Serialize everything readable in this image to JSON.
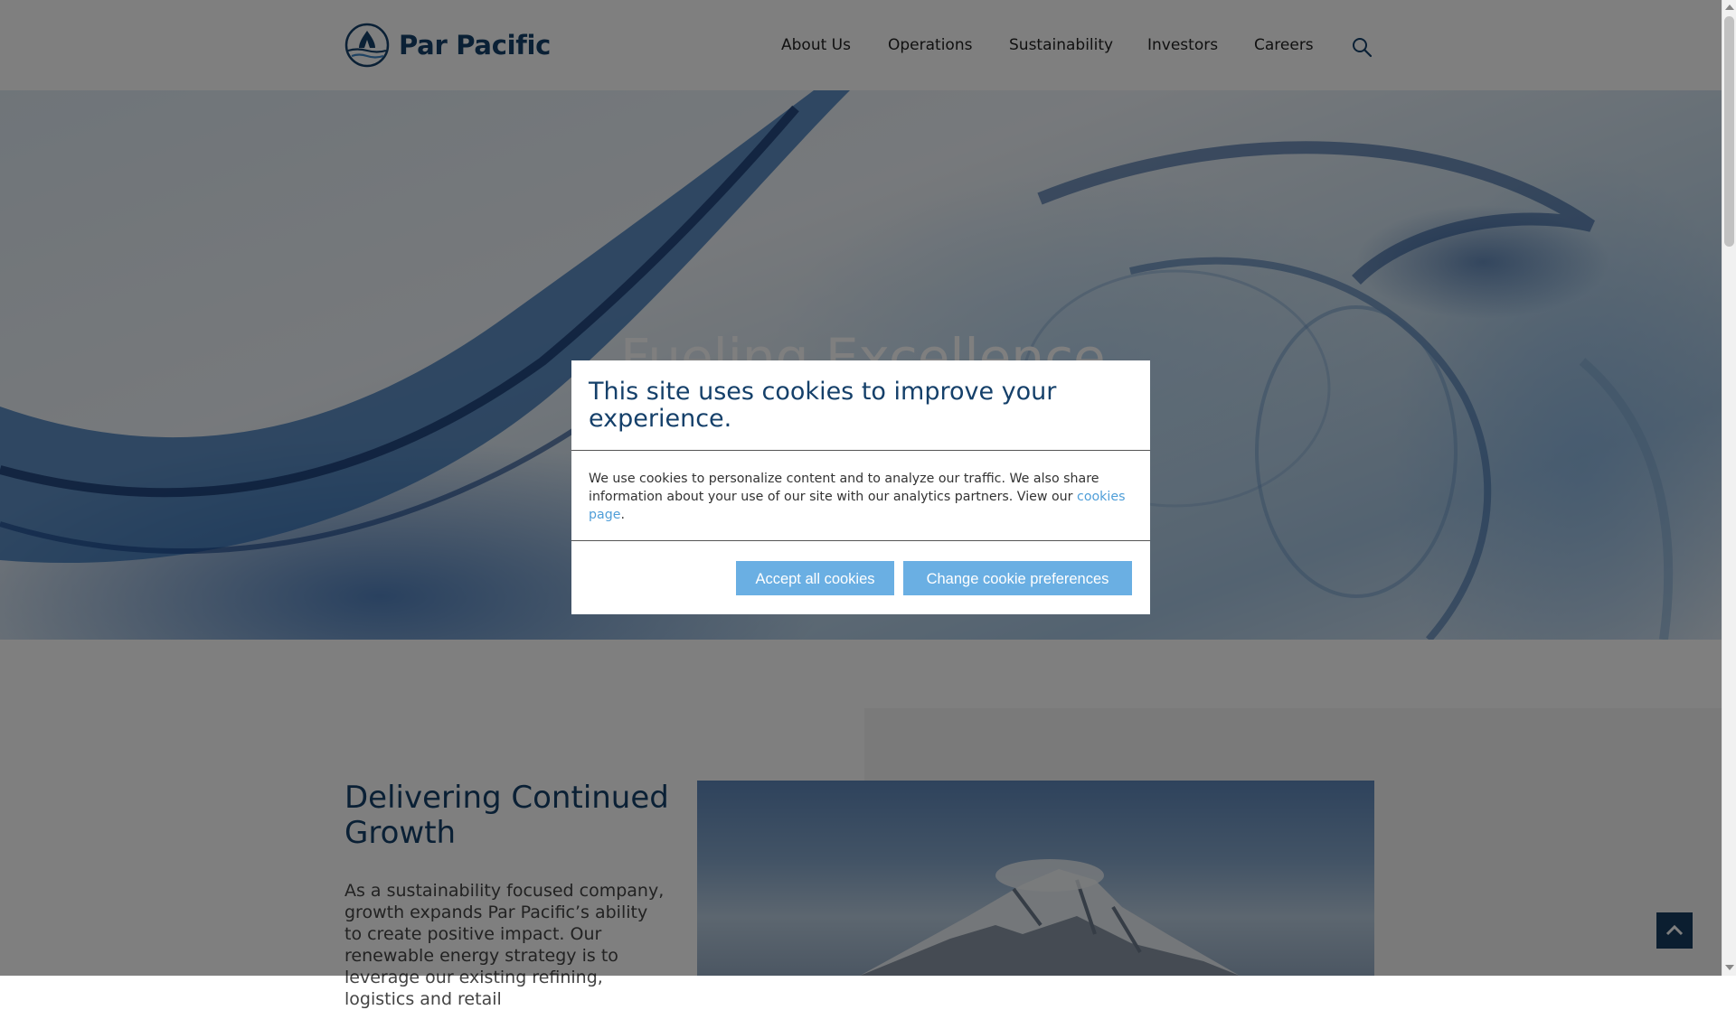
{
  "brand": {
    "name": "Par Pacific",
    "logo_icon": "par-pacific-wave-logo",
    "color": "#15406a"
  },
  "nav": {
    "items": [
      {
        "label": "About Us"
      },
      {
        "label": "Operations"
      },
      {
        "label": "Sustainability"
      },
      {
        "label": "Investors"
      },
      {
        "label": "Careers"
      }
    ],
    "search_icon": "search-icon"
  },
  "hero": {
    "title": "Fueling Excellence"
  },
  "growth": {
    "title": "Delivering Continued Growth",
    "body": "As a sustainability focused company, growth expands Par Pacific’s ability to create positive impact. Our renewable energy strategy is to leverage our existing refining, logistics and retail"
  },
  "cookie_modal": {
    "title": "This site uses cookies to improve your experience.",
    "body": "We use cookies to personalize content and to analyze our traffic. We also share information about your use of our site with our analytics partners. View our ",
    "link_label": "cookies page",
    "body_end": ".",
    "accept_label": "Accept all cookies",
    "preferences_label": "Change cookie preferences",
    "button_color": "#6aafe3",
    "link_color": "#4f9ed8"
  },
  "back_to_top_icon": "chevron-up-icon"
}
